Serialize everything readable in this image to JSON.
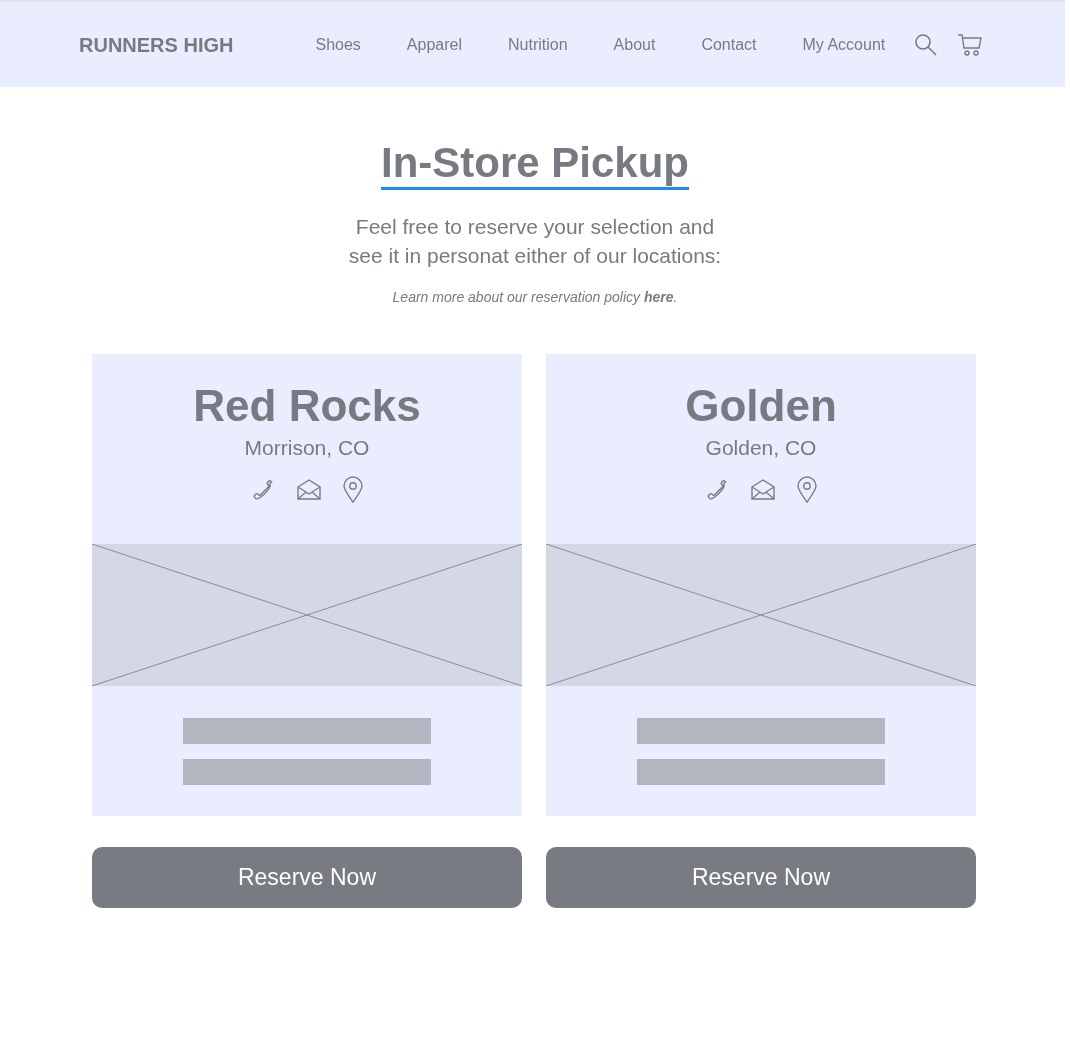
{
  "header": {
    "logo": "RUNNERS HIGH",
    "nav": [
      "Shoes",
      "Apparel",
      "Nutrition",
      "About",
      "Contact",
      "My Account"
    ]
  },
  "title": "In-Store Pickup",
  "intro_lines": [
    "Feel free to reserve your selection and",
    "see it in personat either of our locations:"
  ],
  "policy": {
    "before": "Learn more about our reservation policy ",
    "link": "here",
    "after": "."
  },
  "locations": [
    {
      "name": "Red Rocks",
      "city": "Morrison, CO",
      "button": "Reserve Now"
    },
    {
      "name": "Golden",
      "city": "Golden, CO",
      "button": "Reserve Now"
    }
  ]
}
